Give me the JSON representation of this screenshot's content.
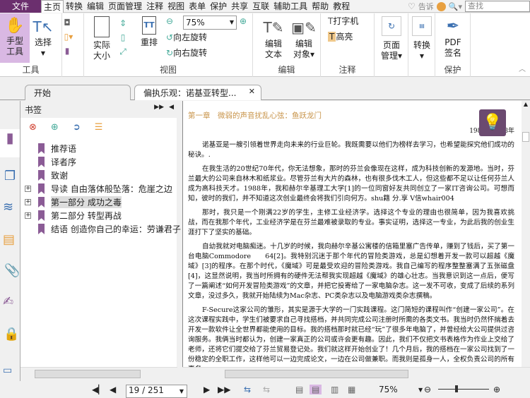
{
  "menubar": {
    "file": "文件",
    "tabs": [
      "主页",
      "转换",
      "编辑",
      "页面管理",
      "注释",
      "视图",
      "表单",
      "保护",
      "共享",
      "互联",
      "辅助工具",
      "帮助",
      "教程"
    ],
    "tell": "告诉",
    "search_placeholder": "查找"
  },
  "ribbon": {
    "tools": {
      "hand": "手型\n工具",
      "hand1": "手型",
      "hand2": "工具",
      "select": "选择",
      "label": "工具"
    },
    "view": {
      "actual1": "实际",
      "actual2": "大小",
      "reflow": "重排",
      "zoom": "75%",
      "rotate_left": "向左旋转",
      "rotate_right": "向右旋转",
      "label": "视图"
    },
    "edit": {
      "text1": "编辑",
      "text2": "文本",
      "obj1": "编辑",
      "obj2": "对象",
      "label": "编辑"
    },
    "comment": {
      "typewriter": "打字机",
      "highlight": "高亮",
      "label": "注释"
    },
    "page": {
      "p1": "页面",
      "p2": "管理"
    },
    "convert": {
      "c": "转换"
    },
    "protect": {
      "s1": "PDF",
      "s2": "签名",
      "label": "保护"
    }
  },
  "tabs": [
    {
      "label": "开始"
    },
    {
      "label": "偏执乐观：诺基亚转型..."
    }
  ],
  "bookmarks": {
    "title": "书签",
    "items": [
      {
        "label": "推荐语",
        "expandable": false
      },
      {
        "label": "译者序",
        "expandable": false
      },
      {
        "label": "致谢",
        "expandable": false
      },
      {
        "label": "导读 自由落体般坠落：危崖之边",
        "expandable": true
      },
      {
        "label": "第一部分 成功之毒",
        "expandable": true,
        "selected": true
      },
      {
        "label": "第二部分 转型再战",
        "expandable": true
      },
      {
        "label": "结语 创造你自己的幸运：劳谦君子",
        "expandable": false
      }
    ]
  },
  "document": {
    "chapter": "第一章　微弱的声音扰乱心弦：鱼跃龙门",
    "years": "1988—2008年",
    "paragraphs": [
      "诺基亚是一艘引领着世界走向未来的行业巨轮。我既需要以他们为榜样去学习，也希望能探究他们成功的秘诀。.",
      "在我生活的20世纪70年代，你无法想象，那时的芬兰会像现在这样，成为科技创新的发源地。当时，芬兰最大的公司来自林木和纸浆业。尽管芬兰有大片的森林，也有很多伐木工人，但这些都不足以让任何芬兰人成为高科技天才。1988年，我和赫尔辛基理工大学[1]的一位同窗好友共同创立了一家IT咨询公司。可想而知，彼时的我们，并不知道这次创业最终会将我们引向何方。shu籍 分.享 V信whair004",
      "那时，我只是一个刚满22岁的学生，主修工业经济学。选择这个专业的理由也很简单，因为我喜欢挑战，而在我那个年代，工业经济学是在芬兰最难被录取的专业。事实证明，选择这一专业，为此后我的创业生涯打下了坚实的基础。",
      "自幼我就对电脑痴迷。十几岁的时候，我向赫尔辛基公寓楼的信箱里塞广告传单，赚到了钱后，买了第一台电脑Commodore　　64[2]。我特别沉迷于那个年代的冒险类游戏，总是幻想着开发一款可以超越《魔域》[3]的程序。在那个时代，《魔域》可是最受欢迎的冒险类游戏。我自己编写的程序整整塞满了五张磁盘[4]，这显然说明，我当时所拥有的硬件无法帮我实现超越《魔域》的雄心壮志。当我意识到这一点后，便写了一篇阐述“如何开发冒险类游戏”的文章，并把它投寄给了一家电脑杂志。这一发不可收，变成了后续的系列文章，没过多久，我就开始陆续为Mac杂志、PC类杂志以及电脑游戏类杂志撰稿。",
      "F-Secure这家公司的雏形，其实是源于大学的一门实践课程。这门简短的课程叫作“创建一家公司”。在这次课程实践中，学生们被要求自己寻找搭档，并共同完成公司注册时所需的各类文书。我当时仍然怀揣着去开发一款软件让全世界都能使用的目标。我的搭档那时就已经“玩”了很多年电脑了，并曾经给大公司提供过咨询服务。我俩当时都认为，创建一家真正的公司或许会更有趣。因此，我们不仅把文书表格作为作业上交给了老师，还将它们提交给了芬兰贸易登记处。我们就这样开始创业了！几个月后，我的搭档在一家公司找到了一份稳定的全职工作，这样他可以一边完成论文，一边在公司做兼职。而我则是孤身一人，全权负责公司的所有事务。"
    ]
  },
  "statusbar": {
    "page": "19 / 251",
    "zoom": "75%"
  },
  "colors": {
    "brand": "#6b2f6e",
    "bookmark": "#8b5c96",
    "chapter": "#c8944a",
    "hand_bg": "#d9b8e3"
  }
}
